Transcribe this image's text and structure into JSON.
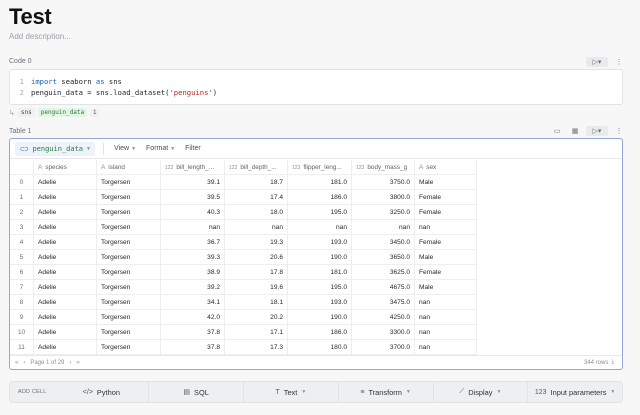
{
  "page": {
    "title": "Test",
    "description_placeholder": "Add description..."
  },
  "code_cell": {
    "label": "Code 0",
    "lines": [
      {
        "no": "1",
        "kw": "import",
        "rest1": " seaborn ",
        "kw2": "as",
        "rest2": " sns",
        "str": ""
      },
      {
        "no": "2",
        "kw": "",
        "rest1": "penguin_data = sns.load_dataset(",
        "kw2": "",
        "rest2": ")",
        "str": "'penguins'"
      }
    ],
    "variables": [
      "sns",
      "penguin_data"
    ],
    "variable_count": "1"
  },
  "table_cell": {
    "label": "Table 1",
    "dataframe": "penguin_data",
    "toolbar": {
      "view": "View",
      "format": "Format",
      "filter": "Filter"
    },
    "columns": [
      {
        "label": "species",
        "type": "A"
      },
      {
        "label": "island",
        "type": "A"
      },
      {
        "label": "bill_length_...",
        "type": "123"
      },
      {
        "label": "bill_depth_...",
        "type": "123"
      },
      {
        "label": "flipper_leng...",
        "type": "123"
      },
      {
        "label": "body_mass_g",
        "type": "123"
      },
      {
        "label": "sex",
        "type": "A"
      }
    ],
    "rows": [
      [
        "0",
        "Adelie",
        "Torgersen",
        "39.1",
        "18.7",
        "181.0",
        "3750.0",
        "Male"
      ],
      [
        "1",
        "Adelie",
        "Torgersen",
        "39.5",
        "17.4",
        "186.0",
        "3800.0",
        "Female"
      ],
      [
        "2",
        "Adelie",
        "Torgersen",
        "40.3",
        "18.0",
        "195.0",
        "3250.0",
        "Female"
      ],
      [
        "3",
        "Adelie",
        "Torgersen",
        "nan",
        "nan",
        "nan",
        "nan",
        "nan"
      ],
      [
        "4",
        "Adelie",
        "Torgersen",
        "36.7",
        "19.3",
        "193.0",
        "3450.0",
        "Female"
      ],
      [
        "5",
        "Adelie",
        "Torgersen",
        "39.3",
        "20.6",
        "190.0",
        "3650.0",
        "Male"
      ],
      [
        "6",
        "Adelie",
        "Torgersen",
        "38.9",
        "17.8",
        "181.0",
        "3625.0",
        "Female"
      ],
      [
        "7",
        "Adelie",
        "Torgersen",
        "39.2",
        "19.6",
        "195.0",
        "4675.0",
        "Male"
      ],
      [
        "8",
        "Adelie",
        "Torgersen",
        "34.1",
        "18.1",
        "193.0",
        "3475.0",
        "nan"
      ],
      [
        "9",
        "Adelie",
        "Torgersen",
        "42.0",
        "20.2",
        "190.0",
        "4250.0",
        "nan"
      ],
      [
        "10",
        "Adelie",
        "Torgersen",
        "37.8",
        "17.1",
        "186.0",
        "3300.0",
        "nan"
      ],
      [
        "11",
        "Adelie",
        "Torgersen",
        "37.8",
        "17.3",
        "180.0",
        "3700.0",
        "nan"
      ]
    ],
    "footer": {
      "page_label": "Page 1 of 29",
      "rows_label": "344 rows"
    }
  },
  "add_cell": {
    "label": "ADD CELL",
    "buttons": [
      {
        "icon": "</>",
        "label": "Python",
        "has_menu": false
      },
      {
        "icon": "▤",
        "label": "SQL",
        "has_menu": false
      },
      {
        "icon": "T",
        "label": "Text",
        "has_menu": true
      },
      {
        "icon": "≡",
        "label": "Transform",
        "has_menu": true
      },
      {
        "icon": "⟋",
        "label": "Display",
        "has_menu": true
      },
      {
        "icon": "123",
        "label": "Input parameters",
        "has_menu": true
      }
    ]
  },
  "colors": {
    "accent_border": "#8fa8d8",
    "variable_green": "#2d7a3f",
    "keyword_blue": "#1a5fb4",
    "string_red": "#b3261e"
  }
}
